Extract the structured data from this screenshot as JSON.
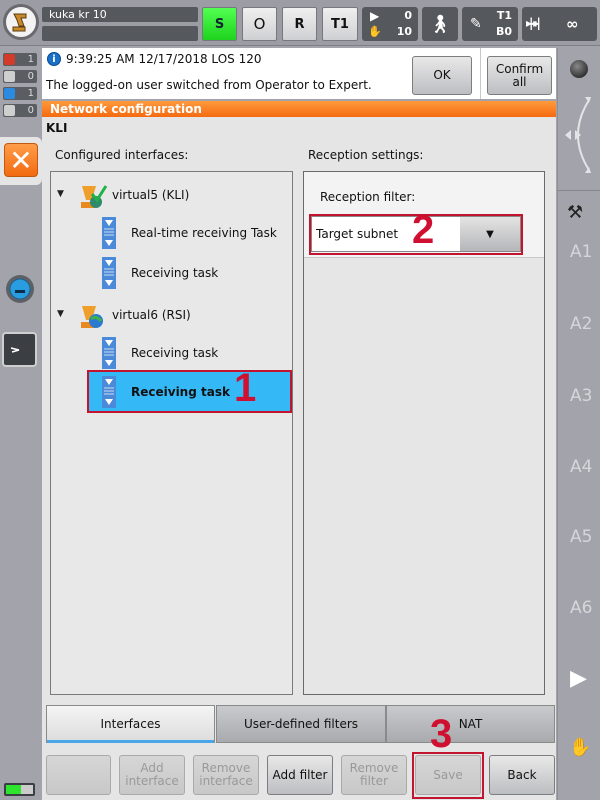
{
  "topbar": {
    "robot_name": "kuka kr 10",
    "robot_subtitle": "",
    "submit_interpreter": "S",
    "drives": "O",
    "robot_interpreter": "R",
    "operating_mode": "T1",
    "program_override": "0",
    "jog_override": "10",
    "tool": "T1",
    "base": "B0",
    "increment": "∞"
  },
  "message_counters": [
    {
      "type": "error",
      "count": "1",
      "color": "#d23a2a"
    },
    {
      "type": "warning",
      "count": "0",
      "color": "#cfcfcf"
    },
    {
      "type": "info",
      "count": "1",
      "color": "#2a8be0"
    },
    {
      "type": "ack",
      "count": "0",
      "color": "#cfcfcf"
    }
  ],
  "message": {
    "time": "9:39:25 AM 12/17/2018 LOS 120",
    "text": "The logged-on user switched from Operator to Expert.",
    "ok_label": "OK",
    "confirm_all_label": "Confirm all"
  },
  "window": {
    "title": "Network configuration",
    "subtitle": "KLI"
  },
  "interfaces": {
    "label": "Configured interfaces:",
    "items": [
      {
        "name": "virtual5 (KLI)",
        "tasks": [
          "Real-time receiving Task",
          "Receiving task"
        ]
      },
      {
        "name": "virtual6 (RSI)",
        "tasks": [
          "Receiving task",
          "Receiving task"
        ]
      }
    ],
    "selected": "Receiving task"
  },
  "reception": {
    "label": "Reception settings:",
    "filter_label": "Reception filter:",
    "filter_value": "Target subnet"
  },
  "annotations": [
    "1",
    "2",
    "3"
  ],
  "tabs": [
    "Interfaces",
    "User-defined filters",
    "NAT"
  ],
  "active_tab": "Interfaces",
  "buttons": {
    "blank": "",
    "add_interface": "Add interface",
    "remove_interface": "Remove interface",
    "add_filter": "Add filter",
    "remove_filter": "Remove filter",
    "save": "Save",
    "back": "Back"
  },
  "right_bar": {
    "axes": [
      "A1",
      "A2",
      "A3",
      "A4",
      "A5",
      "A6"
    ]
  },
  "battery_level": 0.55
}
